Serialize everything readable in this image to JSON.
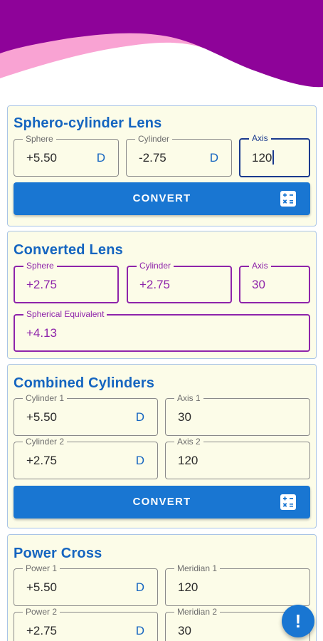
{
  "colors": {
    "header_wave_purple": "#8e0399",
    "header_wave_pink": "#f9a3d3",
    "card_bg": "#fcfce8",
    "accent_blue": "#1976d2",
    "title_blue": "#1565c0",
    "result_purple": "#8e24aa"
  },
  "sphero_cylinder": {
    "title": "Sphero-cylinder Lens",
    "sphere": {
      "label": "Sphere",
      "value": "+5.50",
      "unit": "D"
    },
    "cylinder": {
      "label": "Cylinder",
      "value": "-2.75",
      "unit": "D"
    },
    "axis": {
      "label": "Axis",
      "value": "120"
    },
    "convert_label": "CONVERT",
    "convert_icon": "calculator-icon"
  },
  "converted_lens": {
    "title": "Converted Lens",
    "sphere": {
      "label": "Sphere",
      "value": "+2.75"
    },
    "cylinder": {
      "label": "Cylinder",
      "value": "+2.75"
    },
    "axis": {
      "label": "Axis",
      "value": "30"
    },
    "spherical_equivalent": {
      "label": "Spherical Equivalent",
      "value": "+4.13"
    }
  },
  "combined_cylinders": {
    "title": "Combined Cylinders",
    "cylinder1": {
      "label": "Cylinder 1",
      "value": "+5.50",
      "unit": "D"
    },
    "axis1": {
      "label": "Axis 1",
      "value": "30"
    },
    "cylinder2": {
      "label": "Cylinder 2",
      "value": "+2.75",
      "unit": "D"
    },
    "axis2": {
      "label": "Axis 2",
      "value": "120"
    },
    "convert_label": "CONVERT",
    "convert_icon": "calculator-icon"
  },
  "power_cross": {
    "title": "Power Cross",
    "power1": {
      "label": "Power 1",
      "value": "+5.50",
      "unit": "D"
    },
    "meridian1": {
      "label": "Meridian 1",
      "value": "120"
    },
    "power2": {
      "label": "Power 2",
      "value": "+2.75",
      "unit": "D"
    },
    "meridian2": {
      "label": "Meridian 2",
      "value": "30"
    }
  },
  "fab": {
    "glyph": "!",
    "icon": "alert-icon"
  }
}
